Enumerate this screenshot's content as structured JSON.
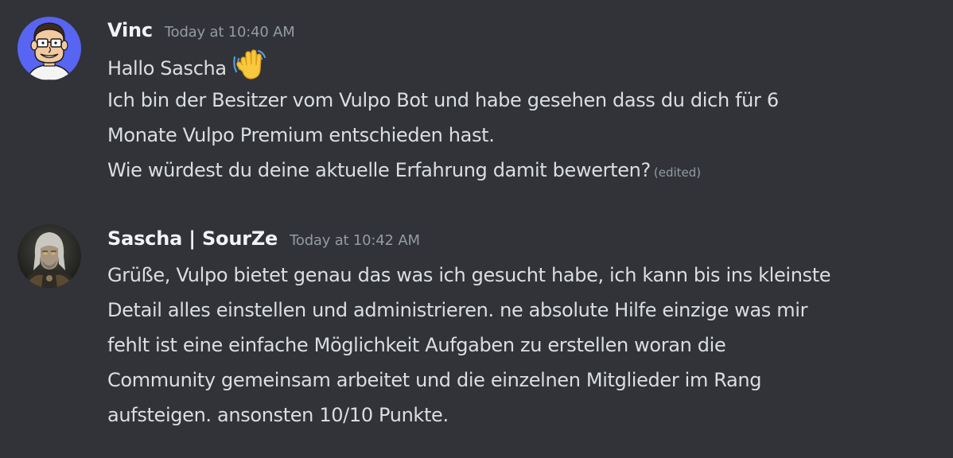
{
  "messages": [
    {
      "author": "Vinc",
      "timestamp": "Today at 10:40 AM",
      "avatar_icon": "cartoon-man-avatar",
      "lines": [
        "Hallo Sascha",
        "Ich bin der Besitzer vom Vulpo Bot und habe gesehen dass du dich für 6",
        "Monate Vulpo Premium entschieden hast.",
        "Wie würdest du deine aktuelle Erfahrung damit bewerten?"
      ],
      "emoji": "waving-hand-icon",
      "edited_label": "(edited)"
    },
    {
      "author": "Sascha | SourZe",
      "timestamp": "Today at 10:42 AM",
      "avatar_icon": "witcher-avatar",
      "lines": [
        "Grüße, Vulpo bietet genau das was ich gesucht habe, ich kann bis ins kleinste",
        "Detail alles einstellen und administrieren. ne absolute Hilfe einzige was mir",
        "fehlt ist eine einfache Möglichkeit Aufgaben zu erstellen woran die",
        "Community gemeinsam arbeitet und die einzelnen Mitglieder im Rang",
        "aufsteigen. ansonsten 10/10 Punkte."
      ]
    }
  ],
  "colors": {
    "background": "#313338",
    "username": "#f2f3f5",
    "text": "#dbdee1",
    "muted": "#949ba4",
    "avatar_blue": "#5865f2"
  }
}
